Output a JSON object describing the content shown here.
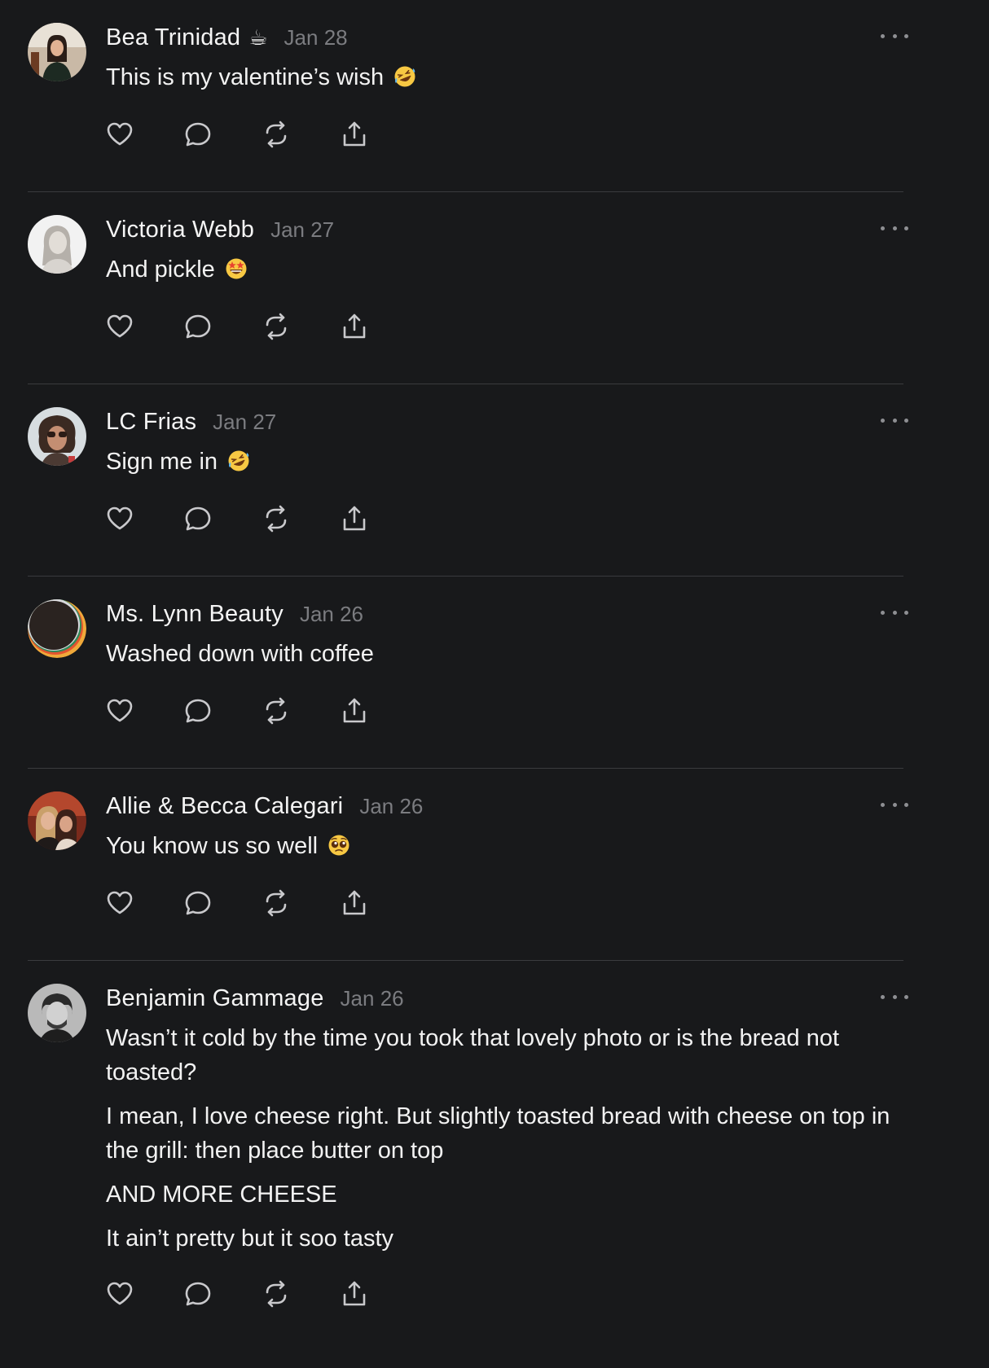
{
  "posts": [
    {
      "name": "Bea Trinidad",
      "badge": "☕",
      "date": "Jan 28",
      "paragraphs": [
        "This is my valentine’s wish"
      ],
      "emoji": "rofl"
    },
    {
      "name": "Victoria Webb",
      "badge": "",
      "date": "Jan 27",
      "paragraphs": [
        "And pickle"
      ],
      "emoji": "star-struck"
    },
    {
      "name": "LC Frias",
      "badge": "",
      "date": "Jan 27",
      "paragraphs": [
        "Sign me in"
      ],
      "emoji": "rofl"
    },
    {
      "name": "Ms. Lynn Beauty",
      "badge": "",
      "date": "Jan 26",
      "paragraphs": [
        "Washed down with coffee"
      ],
      "emoji": ""
    },
    {
      "name": "Allie & Becca Calegari",
      "badge": "",
      "date": "Jan 26",
      "paragraphs": [
        "You know us so well"
      ],
      "emoji": "pleading"
    },
    {
      "name": "Benjamin Gammage",
      "badge": "",
      "date": "Jan 26",
      "paragraphs": [
        "Wasn’t it cold by the time you took that lovely photo or is the bread not toasted?",
        "I mean, I love cheese right. But slightly toasted bread with cheese on top in the grill: then place butter on top",
        "AND MORE CHEESE",
        "It ain’t pretty but it soo tasty"
      ],
      "emoji": ""
    }
  ],
  "icons": {
    "like": "heart-icon",
    "reply": "comment-icon",
    "repost": "repost-icon",
    "share": "share-icon",
    "more": "more-icon"
  },
  "colors": {
    "background": "#18191b",
    "text": "#f3f3f3",
    "muted": "#7b7c80",
    "divider": "#3a3b3e",
    "icon": "#c9c9cc"
  }
}
